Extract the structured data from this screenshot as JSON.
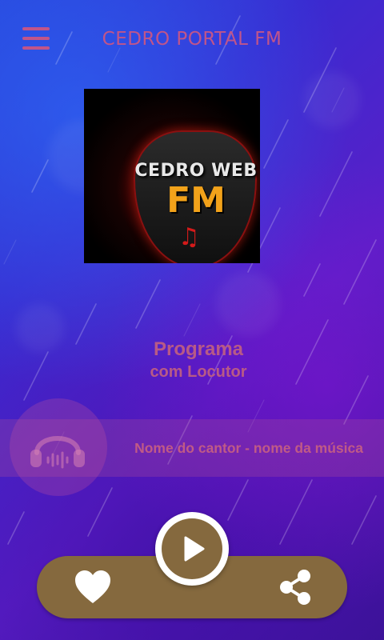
{
  "header": {
    "title": "CEDRO PORTAL FM",
    "menu_icon": "hamburger-menu-icon"
  },
  "logo": {
    "line1": "CEDRO WEB",
    "line2": "FM",
    "note_glyph": "♫",
    "note_icon": "music-note-icon"
  },
  "program": {
    "title": "Programa",
    "host": "com Locutor"
  },
  "now_playing": {
    "track": "Nome do cantor - nome da música",
    "icon": "headphones-icon"
  },
  "controls": {
    "favorite_icon": "heart-icon",
    "play_icon": "play-icon",
    "share_icon": "share-icon"
  },
  "colors": {
    "accent_text": "#c0558a",
    "control_bar": "#85693e",
    "play_ring": "#ffffff"
  }
}
